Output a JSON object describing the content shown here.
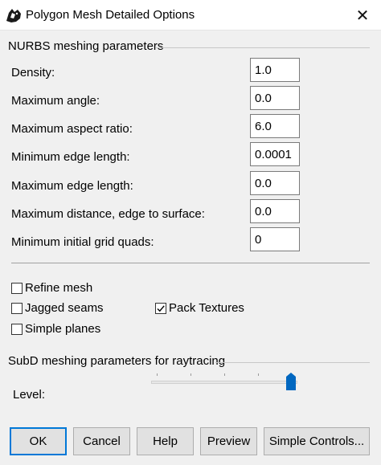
{
  "window": {
    "title": "Polygon Mesh Detailed Options",
    "close_glyph": "✕"
  },
  "nurbs": {
    "section_title": "NURBS meshing parameters",
    "fields": [
      {
        "label": "Density:",
        "value": "1.0"
      },
      {
        "label": "Maximum angle:",
        "value": "0.0"
      },
      {
        "label": "Maximum aspect ratio:",
        "value": "6.0"
      },
      {
        "label": "Minimum edge length:",
        "value": "0.0001"
      },
      {
        "label": "Maximum edge length:",
        "value": "0.0"
      },
      {
        "label": "Maximum distance, edge to surface:",
        "value": "0.0"
      },
      {
        "label": "Minimum initial grid quads:",
        "value": "0"
      }
    ]
  },
  "options": {
    "refine_mesh": {
      "label": "Refine mesh",
      "checked": false
    },
    "jagged_seams": {
      "label": "Jagged seams",
      "checked": false
    },
    "simple_planes": {
      "label": "Simple planes",
      "checked": false
    },
    "pack_textures": {
      "label": "Pack Textures",
      "checked": true
    }
  },
  "subd": {
    "section_title": "SubD meshing parameters for raytracing",
    "level_label": "Level:",
    "level_fraction": 1.0
  },
  "buttons": {
    "ok": "OK",
    "cancel": "Cancel",
    "help": "Help",
    "preview": "Preview",
    "simple_controls": "Simple Controls..."
  },
  "colors": {
    "accent": "#0078d7",
    "slider_thumb": "#0067c0",
    "window_bg": "#f0f0f0"
  }
}
